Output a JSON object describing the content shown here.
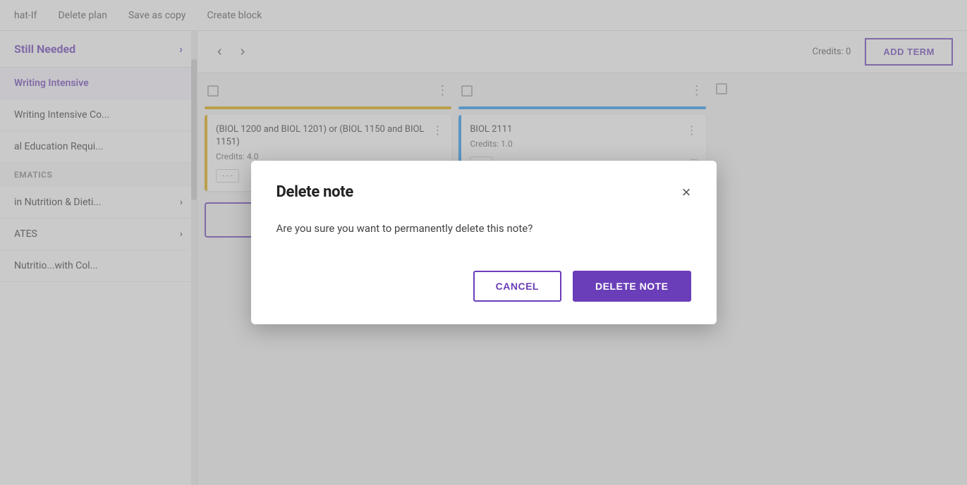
{
  "topnav": {
    "items": [
      {
        "label": "hat-If",
        "id": "what-if"
      },
      {
        "label": "Delete plan",
        "id": "delete-plan"
      },
      {
        "label": "Save as copy",
        "id": "save-copy"
      },
      {
        "label": "Create block",
        "id": "create-block"
      }
    ]
  },
  "sidebar": {
    "still_needed_label": "Still Needed",
    "items": [
      {
        "label": "Writing Intensive",
        "highlight": true
      },
      {
        "label": "Writing Intensive Co...",
        "highlight": false
      },
      {
        "label": "al Education Requi...",
        "highlight": false
      },
      {
        "label": "EMATICS",
        "highlight": false,
        "section": true
      },
      {
        "label": "in Nutrition & Dieti...",
        "highlight": false,
        "has_arrow": true
      },
      {
        "label": "ATES",
        "highlight": false,
        "has_arrow": true
      },
      {
        "label": "Nutritio...with Col...",
        "highlight": false
      }
    ]
  },
  "header": {
    "add_term_label": "ADD TERM",
    "credits_label": "Credits: 0"
  },
  "cards": {
    "card1": {
      "title": "(BIOL 1200 and BIOL 1201) or (BIOL 1150 and BIOL 1151)",
      "credits": "Credits: 4.0",
      "dots": "- - -",
      "border": "orange"
    },
    "card2": {
      "title": "BIOL 2111",
      "credits": "Credits: 1.0",
      "dots": "- - -",
      "border": "blue"
    }
  },
  "modal": {
    "title": "Delete note",
    "body": "Are you sure you want to permanently delete this note?",
    "cancel_label": "CANCEL",
    "delete_label": "DELETE NOTE",
    "close_icon": "×"
  }
}
